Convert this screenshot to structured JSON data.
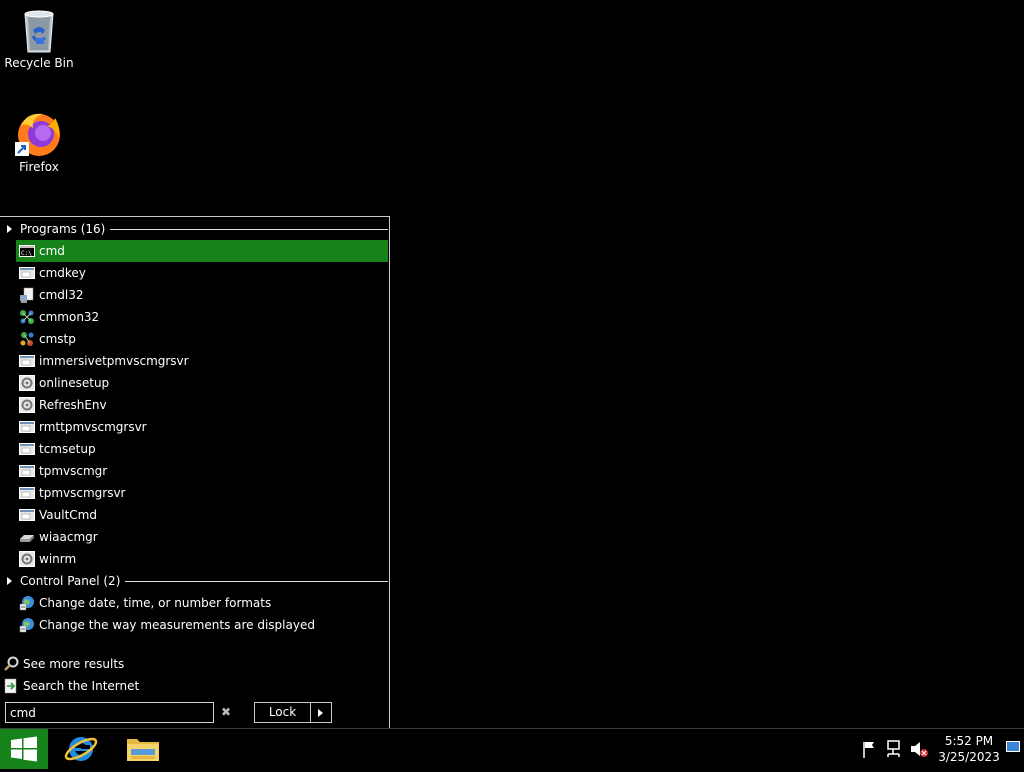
{
  "desktop": {
    "icons": [
      {
        "label": "Recycle Bin",
        "icon": "recycle-bin-icon"
      },
      {
        "label": "Firefox",
        "icon": "firefox-icon"
      }
    ]
  },
  "start_menu": {
    "programs_header": "Programs (16)",
    "programs": [
      {
        "label": "cmd",
        "icon": "console-icon",
        "selected": true
      },
      {
        "label": "cmdkey",
        "icon": "window-app-icon"
      },
      {
        "label": "cmdl32",
        "icon": "network-doc-icon"
      },
      {
        "label": "cmmon32",
        "icon": "connection-manager-icon"
      },
      {
        "label": "cmstp",
        "icon": "connection-manager-icon"
      },
      {
        "label": "immersivetpmvscmgrsvr",
        "icon": "window-app-icon"
      },
      {
        "label": "onlinesetup",
        "icon": "gear-app-icon"
      },
      {
        "label": "RefreshEnv",
        "icon": "gear-app-icon"
      },
      {
        "label": "rmttpmvscmgrsvr",
        "icon": "window-app-icon"
      },
      {
        "label": "tcmsetup",
        "icon": "window-app-icon"
      },
      {
        "label": "tpmvscmgr",
        "icon": "window-app-icon"
      },
      {
        "label": "tpmvscmgrsvr",
        "icon": "window-app-icon"
      },
      {
        "label": "VaultCmd",
        "icon": "window-app-icon"
      },
      {
        "label": "wiaacmgr",
        "icon": "scanner-icon"
      },
      {
        "label": "winrm",
        "icon": "gear-app-icon"
      }
    ],
    "control_panel_header": "Control Panel (2)",
    "control_panel": [
      {
        "label": "Change date, time, or number formats",
        "icon": "region-globe-icon"
      },
      {
        "label": "Change the way measurements are displayed",
        "icon": "region-globe-icon"
      }
    ],
    "see_more": "See more results",
    "search_internet": "Search the Internet",
    "search_value": "cmd",
    "clear_symbol": "✖",
    "lock_label": "Lock"
  },
  "taskbar": {
    "clock_time": "5:52 PM",
    "clock_date": "3/25/2023"
  },
  "colors": {
    "accent_green": "#16821a",
    "background": "#000000"
  }
}
